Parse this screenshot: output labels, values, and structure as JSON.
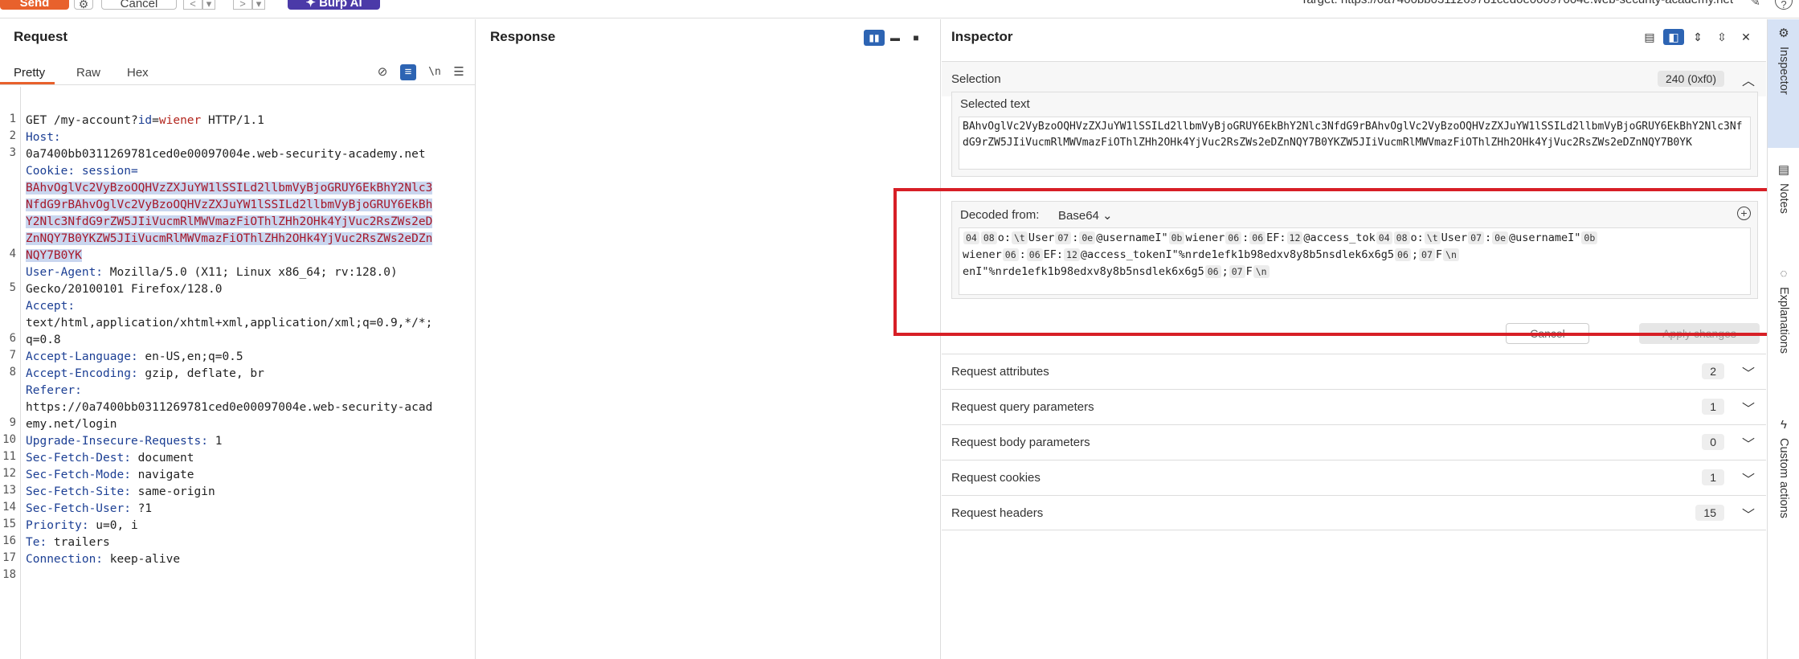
{
  "toolbar": {
    "send": "Send",
    "settings_icon": "gear-icon",
    "cancel": "Cancel",
    "back": "<",
    "forward": ">",
    "burp_ai": "✦ Burp AI",
    "target": "Target: https://0a7400bb0311269781ced0e00097004e.web-security-academy.net",
    "edit_icon": "pencil-icon",
    "help": "?"
  },
  "request": {
    "title": "Request",
    "tabs": [
      "Pretty",
      "Raw",
      "Hex"
    ],
    "line_numbers": [
      "1",
      "2",
      "3",
      "4",
      "5",
      "6",
      "7",
      "8",
      "9",
      "10",
      "11",
      "12",
      "13",
      "14",
      "15",
      "16",
      "17",
      "18"
    ],
    "lines": {
      "l1_method": "GET ",
      "l1_path": "/my-account?",
      "l1_pname": "id",
      "l1_eq": "=",
      "l1_pval": "wiener",
      "l1_proto": " HTTP/1.1",
      "l2_key": "Host:",
      "l2_val": "0a7400bb0311269781ced0e00097004e.web-security-academy.net",
      "l3_key": "Cookie:",
      "l3_cname": " session=",
      "l3_cookie_1": "BAhvOglVc2VyBzoOQHVzZXJuYW1lSSILd2llbmVyBjoGRUY6EkBhY2Nlc3",
      "l3_cookie_2": "NfdG9rBAhvOglVc2VyBzoOQHVzZXJuYW1lSSILd2llbmVyBjoGRUY6EkBh",
      "l3_cookie_3": "Y2Nlc3NfdG9rZW5JIiVucmRlMWVmazFiOThlZHh2OHk4YjVuc2RsZWs2eD",
      "l3_cookie_4": "ZnNQY7B0YKZW5JIiVucmRlMWVmazFiOThlZHh2OHk4YjVuc2RsZWs2eDZn",
      "l3_cookie_5": "NQY7B0YK",
      "l4_key": "User-Agent:",
      "l4_val": " Mozilla/5.0 (X11; Linux x86_64; rv:128.0)",
      "l4_val2": "Gecko/20100101 Firefox/128.0",
      "l5_key": "Accept:",
      "l5_val": "text/html,application/xhtml+xml,application/xml;q=0.9,*/*;",
      "l5_val2": "q=0.8",
      "l6_key": "Accept-Language:",
      "l6_val": " en-US,en;q=0.5",
      "l7_key": "Accept-Encoding:",
      "l7_val": " gzip, deflate, br",
      "l8_key": "Referer:",
      "l8_val": "https://0a7400bb0311269781ced0e00097004e.web-security-acad",
      "l8_val2": "emy.net/login",
      "l9_key": "Upgrade-Insecure-Requests:",
      "l9_val": " 1",
      "l10_key": "Sec-Fetch-Dest:",
      "l10_val": " document",
      "l11_key": "Sec-Fetch-Mode:",
      "l11_val": " navigate",
      "l12_key": "Sec-Fetch-Site:",
      "l12_val": " same-origin",
      "l13_key": "Sec-Fetch-User:",
      "l13_val": " ?1",
      "l14_key": "Priority:",
      "l14_val": " u=0, i",
      "l15_key": "Te:",
      "l15_val": " trailers",
      "l16_key": "Connection:",
      "l16_val": " keep-alive"
    }
  },
  "response": {
    "title": "Response"
  },
  "inspector": {
    "title": "Inspector",
    "selection_label": "Selection",
    "selection_count": "240 (0xf0)",
    "selected_text_label": "Selected text",
    "selected_text": "BAhvOglVc2VyBzoOQHVzZXJuYW1lSSILd2llbmVyBjoGRUY6EkBhY2Nlc3NfdG9rBAhvOglVc2VyBzoOQHVzZXJuYW1lSSILd2llbmVyBjoGRUY6EkBhY2Nlc3NfdG9rZW5JIiVucmRlMWVmazFiOThlZHh2OHk4YjVuc2RsZWs2eDZnNQY7B0YKZW5JIiVucmRlMWVmazFiOThlZHh2OHk4YjVuc2RsZWs2eDZnNQY7B0YK",
    "decoded_label": "Decoded from:",
    "decoded_format": "Base64",
    "decoded": {
      "t1": "o:",
      "t2": "User",
      "t3": ":",
      "t4": "@usernameI\"",
      "t5": "wiener",
      "t6": ":",
      "t7": "EF:",
      "t8": "@access_tok",
      "t9": "o:",
      "t10": "User",
      "t11": ":",
      "t12": "@usernameI\"",
      "t13": "wiener",
      "t14": ":",
      "t15": "EF:",
      "t16": "@access_tokenI\"%nrde1efk1b98edxv8y8b5nsdlek6x6g5",
      "t17": ";",
      "t18": "F",
      "t19": "enI\"%nrde1efk1b98edxv8y8b5nsdlek6x6g5",
      "t20": ";",
      "t21": "F",
      "b_04": "04",
      "b_08": "08",
      "b_t": "\\t",
      "b_07": "07",
      "b_0e": "0e",
      "b_0b": "0b",
      "b_06": "06",
      "b_12": "12",
      "b_n": "\\n"
    },
    "cancel_button": "Cancel",
    "apply_button": "Apply changes",
    "sections": [
      {
        "label": "Request attributes",
        "count": "2"
      },
      {
        "label": "Request query parameters",
        "count": "1"
      },
      {
        "label": "Request body parameters",
        "count": "0"
      },
      {
        "label": "Request cookies",
        "count": "1"
      },
      {
        "label": "Request headers",
        "count": "15"
      }
    ]
  },
  "sidebar": {
    "items": [
      {
        "label": "Inspector",
        "icon": "sliders-icon"
      },
      {
        "label": "Notes",
        "icon": "note-icon"
      },
      {
        "label": "Explanations",
        "icon": "lightbulb-icon"
      },
      {
        "label": "Custom actions",
        "icon": "lightning-icon"
      }
    ]
  },
  "colors": {
    "send": "#e8612c",
    "burp_ai": "#4b3aa8",
    "accent_blue": "#2d64b3",
    "highlight_red": "#d71f26",
    "selection_bg": "#c9d6ef"
  }
}
